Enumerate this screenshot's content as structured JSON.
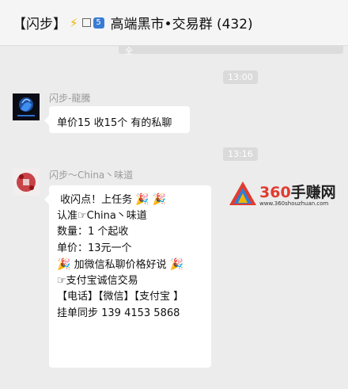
{
  "header": {
    "title_left": "【闪步】",
    "title_icons": [
      "lightning-icon",
      "square-icon",
      "number-five-icon"
    ],
    "badge": "5",
    "title_right": "高端黑市•交易群 (432)"
  },
  "scroll_hint": {
    "label": "全"
  },
  "messages": [
    {
      "time": "13:00",
      "sender": "闪步-龍騰",
      "text": "单价15  收15个  有的私聊"
    },
    {
      "time": "13:16",
      "sender": "闪步～China丶味道",
      "lines": [
        "收闪点！上任务",
        "认准☞China丶味道",
        "数量：1 个起收",
        "单价：13元一个",
        "加微信私聊价格好说",
        "☞支付宝诚信交易",
        "【电话】【微信】【支付宝 】",
        "挂单同步  139 4153 5868"
      ],
      "party_emoji": "🎉"
    }
  ],
  "watermark": {
    "brand_number": "360",
    "brand_text": "手赚网",
    "url": "www.360shouzhuan.com"
  }
}
